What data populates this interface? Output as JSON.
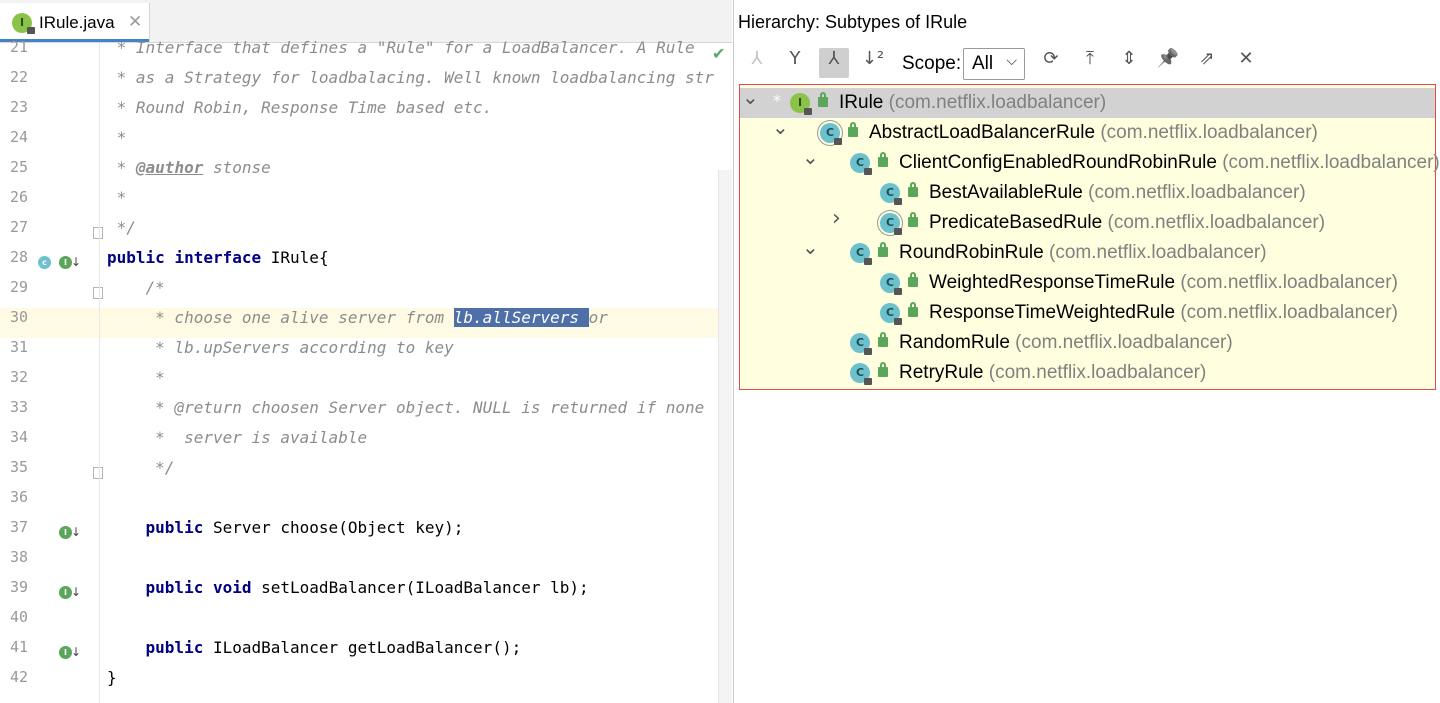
{
  "editor": {
    "tab": {
      "label": "IRule.java",
      "icon": "interface-icon",
      "close_glyph": "✕"
    },
    "lines": [
      {
        "num": "21",
        "segments": [
          {
            "t": " * Interface that defines a \"Rule\" for a LoadBalancer. A Rule",
            "c": "cmt"
          }
        ]
      },
      {
        "num": "22",
        "segments": [
          {
            "t": " * as a Strategy for loadbalacing. Well known loadbalancing str",
            "c": "cmt"
          }
        ]
      },
      {
        "num": "23",
        "segments": [
          {
            "t": " * Round Robin, Response Time based etc.",
            "c": "cmt"
          }
        ]
      },
      {
        "num": "24",
        "segments": [
          {
            "t": " *",
            "c": "cmt"
          }
        ]
      },
      {
        "num": "25",
        "segments": [
          {
            "t": " * ",
            "c": "cmt"
          },
          {
            "t": "@author",
            "c": "tag"
          },
          {
            "t": " stonse",
            "c": "cmt"
          }
        ]
      },
      {
        "num": "26",
        "segments": [
          {
            "t": " *",
            "c": "cmt"
          }
        ]
      },
      {
        "num": "27",
        "segments": [
          {
            "t": " */",
            "c": "cmt"
          }
        ]
      },
      {
        "num": "28",
        "segments": [
          {
            "t": "public",
            "c": "kw"
          },
          {
            "t": " ",
            "c": ""
          },
          {
            "t": "interface",
            "c": "kw"
          },
          {
            "t": " IRule{",
            "c": ""
          }
        ]
      },
      {
        "num": "29",
        "segments": [
          {
            "t": "    /*",
            "c": "cmt"
          }
        ]
      },
      {
        "num": "30",
        "segments": [
          {
            "t": "     * choose one alive server from ",
            "c": "cmt"
          },
          {
            "t": "lb.allServers ",
            "c": "cmt sel"
          },
          {
            "t": "or",
            "c": "cmt"
          }
        ]
      },
      {
        "num": "31",
        "segments": [
          {
            "t": "     * lb.upServers according to key",
            "c": "cmt"
          }
        ]
      },
      {
        "num": "32",
        "segments": [
          {
            "t": "     *",
            "c": "cmt"
          }
        ]
      },
      {
        "num": "33",
        "segments": [
          {
            "t": "     * @return choosen Server object. NULL is returned if none",
            "c": "cmt"
          }
        ]
      },
      {
        "num": "34",
        "segments": [
          {
            "t": "     *  server is available",
            "c": "cmt"
          }
        ]
      },
      {
        "num": "35",
        "segments": [
          {
            "t": "     */",
            "c": "cmt"
          }
        ]
      },
      {
        "num": "36",
        "segments": []
      },
      {
        "num": "37",
        "segments": [
          {
            "t": "    ",
            "c": ""
          },
          {
            "t": "public",
            "c": "kw"
          },
          {
            "t": " Server choose(Object key);",
            "c": ""
          }
        ]
      },
      {
        "num": "38",
        "segments": []
      },
      {
        "num": "39",
        "segments": [
          {
            "t": "    ",
            "c": ""
          },
          {
            "t": "public",
            "c": "kw"
          },
          {
            "t": " ",
            "c": ""
          },
          {
            "t": "void",
            "c": "kw"
          },
          {
            "t": " setLoadBalancer(ILoadBalancer lb);",
            "c": ""
          }
        ]
      },
      {
        "num": "40",
        "segments": []
      },
      {
        "num": "41",
        "segments": [
          {
            "t": "    ",
            "c": ""
          },
          {
            "t": "public",
            "c": "kw"
          },
          {
            "t": " ILoadBalancer getLoadBalancer();",
            "c": ""
          }
        ]
      },
      {
        "num": "42",
        "segments": [
          {
            "t": "}",
            "c": ""
          }
        ]
      }
    ],
    "current_line": "30"
  },
  "hierarchy": {
    "title": "Hierarchy:  Subtypes of IRule",
    "toolbar": {
      "buttons": [
        {
          "name": "supertypes-hierarchy-icon",
          "glyph": "⅄",
          "state": "disabled"
        },
        {
          "name": "type-hierarchy-icon",
          "glyph": "Y",
          "state": "normal"
        },
        {
          "name": "subtypes-hierarchy-icon",
          "glyph": "⅄",
          "state": "active"
        },
        {
          "name": "sort-alphabetically-icon",
          "glyph": "↓²",
          "state": "normal"
        }
      ],
      "scope_label": "Scope:",
      "scope_value": "All",
      "actions": [
        {
          "name": "refresh-icon",
          "glyph": "⟳"
        },
        {
          "name": "export-icon",
          "glyph": "⤒"
        },
        {
          "name": "expand-all-icon",
          "glyph": "⇕"
        },
        {
          "name": "pin-icon",
          "glyph": "📌"
        },
        {
          "name": "open-external-icon",
          "glyph": "⇗"
        },
        {
          "name": "close-icon",
          "glyph": "✕"
        }
      ]
    },
    "tree": [
      {
        "name": "IRule",
        "pkg": "(com.netflix.loadbalancer)",
        "kind": "interface",
        "depth": 0,
        "expand": "expanded",
        "star": true,
        "selected": true
      },
      {
        "name": "AbstractLoadBalancerRule",
        "pkg": "(com.netflix.loadbalancer)",
        "kind": "abstract",
        "depth": 1,
        "expand": "expanded"
      },
      {
        "name": "ClientConfigEnabledRoundRobinRule",
        "pkg": "(com.netflix.loadbalancer)",
        "kind": "class",
        "depth": 2,
        "expand": "expanded"
      },
      {
        "name": "BestAvailableRule",
        "pkg": "(com.netflix.loadbalancer)",
        "kind": "class",
        "depth": 3,
        "expand": "none"
      },
      {
        "name": "PredicateBasedRule",
        "pkg": "(com.netflix.loadbalancer)",
        "kind": "abstract",
        "depth": 3,
        "expand": "collapsed"
      },
      {
        "name": "RoundRobinRule",
        "pkg": "(com.netflix.loadbalancer)",
        "kind": "class",
        "depth": 2,
        "expand": "expanded"
      },
      {
        "name": "WeightedResponseTimeRule",
        "pkg": "(com.netflix.loadbalancer)",
        "kind": "class",
        "depth": 3,
        "expand": "none"
      },
      {
        "name": "ResponseTimeWeightedRule",
        "pkg": "(com.netflix.loadbalancer)",
        "kind": "class",
        "depth": 3,
        "expand": "none"
      },
      {
        "name": "RandomRule",
        "pkg": "(com.netflix.loadbalancer)",
        "kind": "class",
        "depth": 2,
        "expand": "none"
      },
      {
        "name": "RetryRule",
        "pkg": "(com.netflix.loadbalancer)",
        "kind": "class",
        "depth": 2,
        "expand": "none"
      }
    ]
  },
  "colors": {
    "selection": "#4e6fa7",
    "tree_background": "#ffffe0",
    "tree_border": "#e04b4b",
    "current_line": "#fffae3"
  }
}
